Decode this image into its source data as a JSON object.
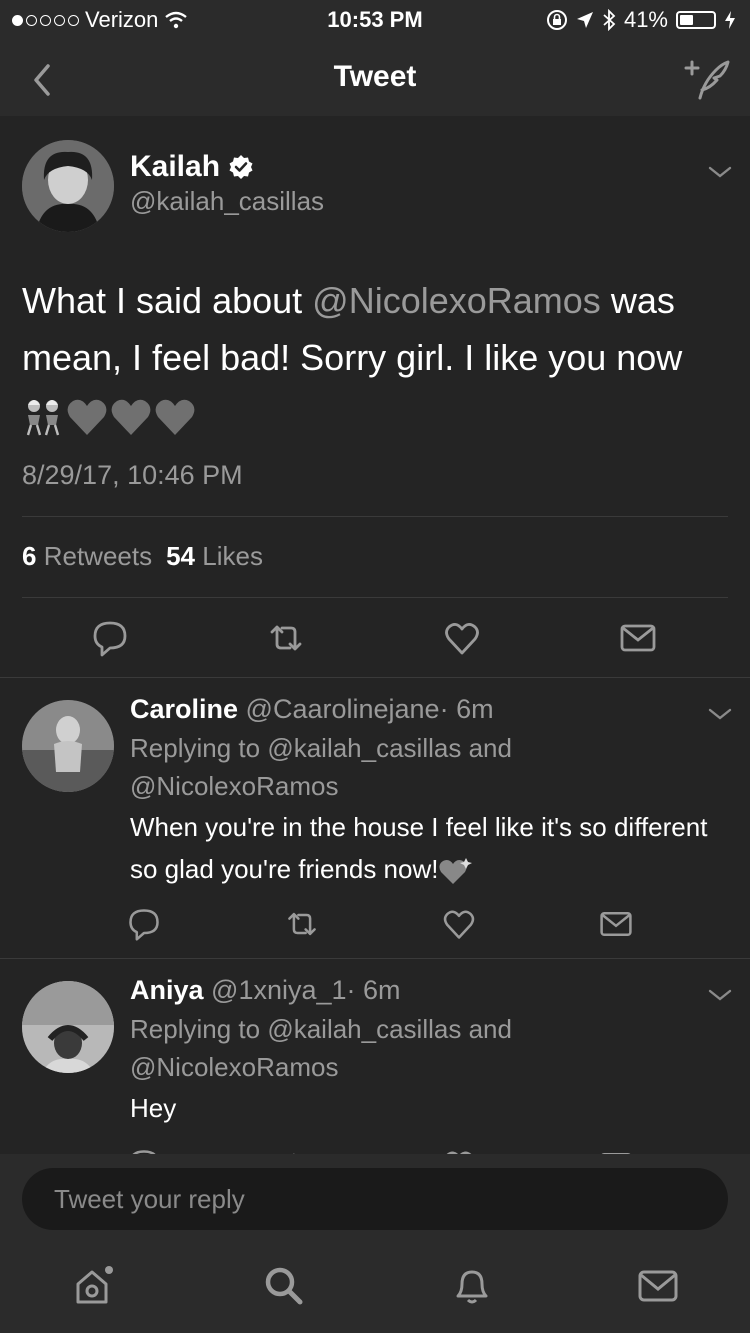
{
  "status": {
    "carrier": "Verizon",
    "time": "10:53 PM",
    "battery": "41%",
    "battery_level": 0.41
  },
  "nav": {
    "title": "Tweet"
  },
  "tweet": {
    "name": "Kailah",
    "handle": "@kailah_casillas",
    "text_pre": "What I said about ",
    "mention": "@NicolexoRamos",
    "text_post": " was mean, I feel bad! Sorry girl. I like you now",
    "date": "8/29/17, 10:46 PM",
    "retweets_count": "6",
    "retweets_label": "Retweets",
    "likes_count": "54",
    "likes_label": "Likes"
  },
  "replies": [
    {
      "name": "Caroline",
      "handle": "@Caarolinejane",
      "time": "· 6m",
      "replying_prefix": "Replying to ",
      "replying_user1": "@kailah_casillas",
      "replying_and": " and",
      "replying_user2": "@NicolexoRamos",
      "text": "When you're in the house I feel like it's so different so glad you're friends now!"
    },
    {
      "name": "Aniya",
      "handle": "@1xniya_1",
      "time": "· 6m",
      "replying_prefix": "Replying to ",
      "replying_user1": "@kailah_casillas",
      "replying_and": " and",
      "replying_user2": "@NicolexoRamos",
      "text": "Hey"
    }
  ],
  "composer": {
    "placeholder": "Tweet your reply"
  },
  "icons": [
    "back-icon",
    "compose-tweet-icon",
    "verified-icon",
    "chevron-down-icon",
    "reply-icon",
    "retweet-icon",
    "like-icon",
    "direct-message-icon",
    "home-icon",
    "search-icon",
    "notifications-icon",
    "messages-icon"
  ]
}
